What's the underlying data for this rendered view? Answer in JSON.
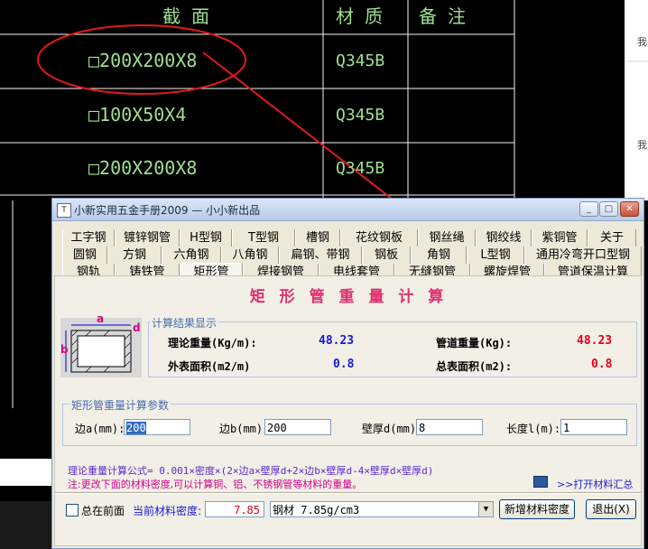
{
  "cad": {
    "headers": [
      "截 面",
      "材 质",
      "备 注"
    ],
    "rows": [
      {
        "section": "□200X200X8",
        "material": "Q345B"
      },
      {
        "section": "□100X50X4",
        "material": "Q345B"
      },
      {
        "section": "□200X200X8",
        "material": "Q345B"
      }
    ],
    "side_char_1": "我",
    "side_char_2": "我"
  },
  "window": {
    "title": "小新实用五金手册2009 — 小小新出品",
    "icon_letter": "T",
    "btn_min": "_",
    "btn_max": "□",
    "btn_close": "✕",
    "tabs_row1": [
      "工字钢",
      "镀锌钢管",
      "H型钢",
      "T型钢",
      "槽钢",
      "花纹钢板",
      "钢丝绳",
      "钢绞线",
      "紫铜管",
      "关于"
    ],
    "tabs_row2": [
      "圆钢",
      "方钢",
      "六角钢",
      "八角钢",
      "扁钢、带钢",
      "钢板",
      "角钢",
      "L型钢",
      "通用冷弯开口型钢"
    ],
    "tabs_row3": [
      "钢轨",
      "铸铁管",
      "矩形管",
      "焊接钢管",
      "电线套管",
      "无缝钢管",
      "螺旋焊管",
      "管道保温计算"
    ],
    "active_tab": "矩形管"
  },
  "panel": {
    "heading": "矩 形 管 重 量 计 算",
    "diagram_a": "a",
    "diagram_b": "b",
    "diagram_d": "d",
    "result_group": "计算结果显示",
    "theory_weight_label": "理论重量(Kg/m):",
    "theory_weight_value": "48.23",
    "pipe_weight_label": "管道重量(Kg):",
    "pipe_weight_value": "48.23",
    "outer_area_label": "外表面积(m2/m)",
    "outer_area_value": "0.8",
    "total_area_label": "总表面积(m2):",
    "total_area_value": "0.8",
    "param_group": "矩形管重量计算参数",
    "side_a_label": "边a(mm):",
    "side_a_value": "200",
    "side_b_label": "边b(mm):",
    "side_b_value": "200",
    "wall_label": "壁厚d(mm):",
    "wall_value": "8",
    "length_label": "长度l(m):",
    "length_value": "1",
    "formula": "理论重量计算公式= 0.001×密度×(2×边a×壁厚d+2×边b×壁厚d-4×壁厚d×壁厚d)",
    "note": "注:更改下面的材料密度,可以计算铜、铝、不锈钢管等材料的重量。",
    "open_summary": ">>打开材料汇总"
  },
  "bottom": {
    "topmost_label": "总在前面",
    "density_label": "当前材料密度:",
    "density_value": "7.85",
    "material_select": "钢材  7.85g/cm3",
    "add_density_button": "新增材料密度",
    "exit_button": "退出(X)"
  },
  "colors": {
    "result_blue": "#1a1ad0",
    "result_red": "#e0001a",
    "heading_pink": "#e0306f",
    "note_red": "#d4008a",
    "formula_purple": "#5a2ad0"
  }
}
